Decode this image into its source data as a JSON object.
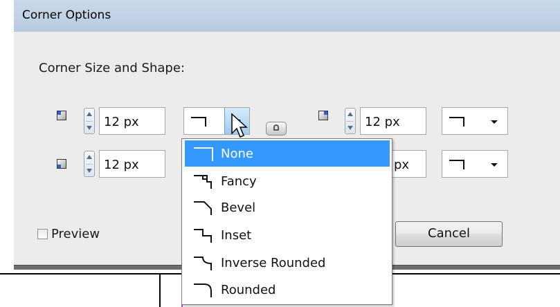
{
  "dialog": {
    "title": "Corner Options",
    "heading": "Corner Size and Shape:",
    "corners": {
      "top_left": {
        "size": "12 px"
      },
      "top_right": {
        "size": "12 px"
      },
      "bottom_left": {
        "size": "12 px"
      },
      "bottom_right": {
        "size": "px"
      }
    },
    "preview_label": "Preview",
    "preview_checked": false,
    "cancel_label": "Cancel"
  },
  "dropdown": {
    "selected": "None",
    "options": [
      {
        "label": "None",
        "icon": "corner-none-icon"
      },
      {
        "label": "Fancy",
        "icon": "corner-fancy-icon"
      },
      {
        "label": "Bevel",
        "icon": "corner-bevel-icon"
      },
      {
        "label": "Inset",
        "icon": "corner-inset-icon"
      },
      {
        "label": "Inverse Rounded",
        "icon": "corner-inverse-rounded-icon"
      },
      {
        "label": "Rounded",
        "icon": "corner-rounded-icon"
      }
    ]
  },
  "colors": {
    "selection": "#3399ff",
    "titlebar": "#c9d9ea",
    "dialog_bg": "#ececec"
  }
}
